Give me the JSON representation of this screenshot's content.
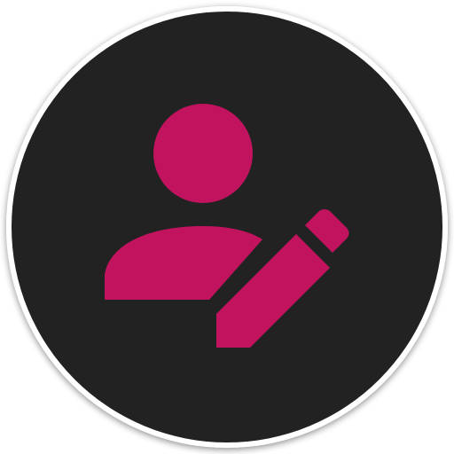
{
  "icon": {
    "name": "user-edit-icon",
    "background_color": "#222222",
    "foreground_color": "#c2135f",
    "border_color": "#ffffff"
  }
}
